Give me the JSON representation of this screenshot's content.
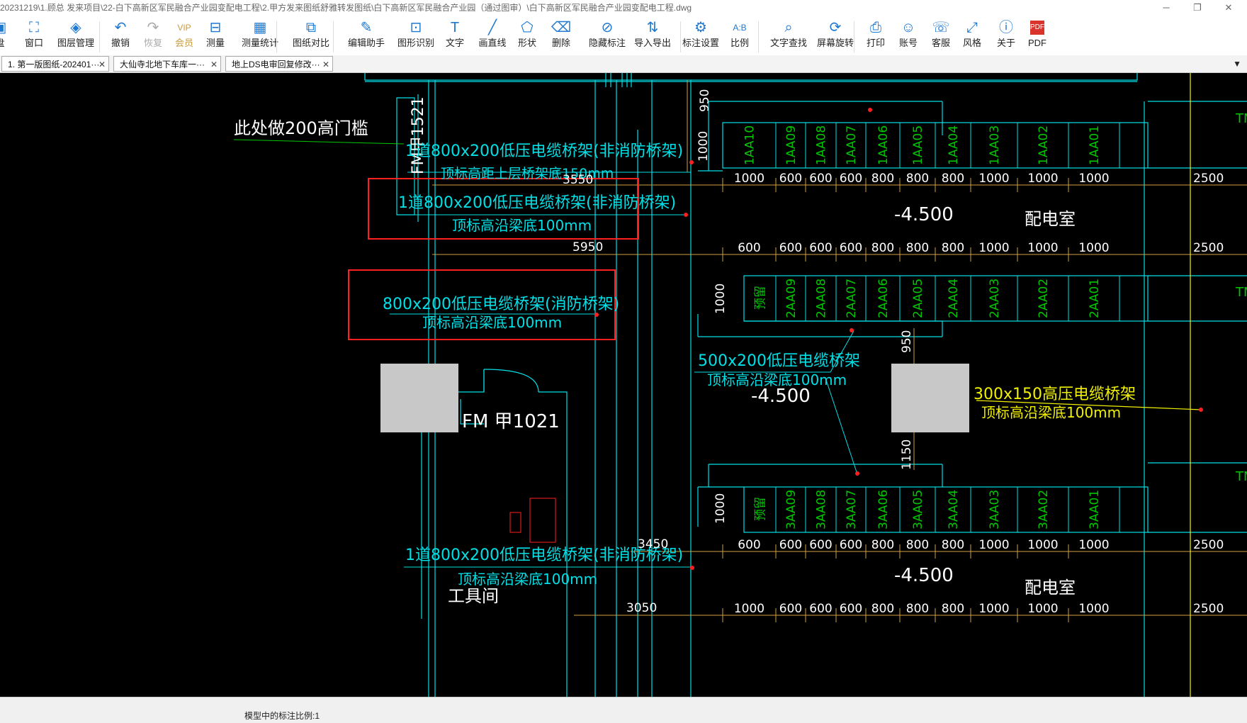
{
  "window": {
    "title": "20231219\\1.顾总 发来项目\\22-白下高新区军民融合产业园变配电工程\\2.甲方发来图纸舒雅转发图纸\\白下高新区军民融合产业园（通过图审）\\白下高新区军民融合产业园变配电工程.dwg",
    "minimize_glyph": "─",
    "maximize_glyph": "❐",
    "close_glyph": "✕"
  },
  "toolbar": [
    {
      "id": "disk",
      "label": "盘",
      "icon": "disk-icon",
      "glyph": "▣"
    },
    {
      "id": "window",
      "label": "窗口",
      "icon": "window-icon",
      "glyph": "⛶"
    },
    {
      "id": "layers",
      "label": "图层管理",
      "icon": "layers-icon",
      "glyph": "◈"
    },
    {
      "id": "undo",
      "label": "撤销",
      "icon": "undo-icon",
      "glyph": "↶"
    },
    {
      "id": "redo",
      "label": "恢复",
      "icon": "redo-icon",
      "glyph": "↷",
      "disabled": true
    },
    {
      "id": "vip",
      "label": "会员",
      "icon": "vip-icon",
      "glyph": "VIP",
      "vip": true
    },
    {
      "id": "measure",
      "label": "测量",
      "icon": "ruler-icon",
      "glyph": "⊟"
    },
    {
      "id": "measure_stats",
      "label": "测量统计",
      "icon": "measure-stats-icon",
      "glyph": "▦"
    },
    {
      "id": "compare",
      "label": "图纸对比",
      "icon": "compare-icon",
      "glyph": "⧉"
    },
    {
      "id": "edit_helper",
      "label": "编辑助手",
      "icon": "edit-helper-icon",
      "glyph": "✎"
    },
    {
      "id": "recognize",
      "label": "图形识别",
      "icon": "recognize-icon",
      "glyph": "⊡"
    },
    {
      "id": "text",
      "label": "文字",
      "icon": "text-icon",
      "glyph": "T"
    },
    {
      "id": "line",
      "label": "画直线",
      "icon": "line-icon",
      "glyph": "╱"
    },
    {
      "id": "shape",
      "label": "形状",
      "icon": "shape-icon",
      "glyph": "⬠"
    },
    {
      "id": "delete",
      "label": "删除",
      "icon": "eraser-icon",
      "glyph": "⌫"
    },
    {
      "id": "hide_annot",
      "label": "隐藏标注",
      "icon": "hide-icon",
      "glyph": "⊘"
    },
    {
      "id": "import_export",
      "label": "导入导出",
      "icon": "import-export-icon",
      "glyph": "⇅"
    },
    {
      "id": "annot_settings",
      "label": "标注设置",
      "icon": "annot-settings-icon",
      "glyph": "⚙"
    },
    {
      "id": "scale",
      "label": "比例",
      "icon": "scale-icon",
      "glyph": "A:B"
    },
    {
      "id": "find_text",
      "label": "文字查找",
      "icon": "find-text-icon",
      "glyph": "⌕"
    },
    {
      "id": "rotate_screen",
      "label": "屏幕旋转",
      "icon": "rotate-icon",
      "glyph": "⟳"
    },
    {
      "id": "print",
      "label": "打印",
      "icon": "printer-icon",
      "glyph": "⎙"
    },
    {
      "id": "account",
      "label": "账号",
      "icon": "account-icon",
      "glyph": "☺"
    },
    {
      "id": "service",
      "label": "客服",
      "icon": "headset-icon",
      "glyph": "☏"
    },
    {
      "id": "style",
      "label": "风格",
      "icon": "style-icon",
      "glyph": "⤢"
    },
    {
      "id": "about",
      "label": "关于",
      "icon": "info-icon",
      "glyph": "ⓘ"
    },
    {
      "id": "pdf",
      "label": "PDF",
      "icon": "pdf-icon",
      "glyph": "PDF"
    }
  ],
  "tabs": [
    {
      "label": "1. 第一版图纸-202401···",
      "close": "✕"
    },
    {
      "label": "大仙寺北地下车库一···",
      "close": "✕"
    },
    {
      "label": "地上DS电审回复修改···",
      "close": "✕"
    }
  ],
  "tab_menu": "▼",
  "status": {
    "text": "模型中的标注比例:1"
  },
  "colors": {
    "cyan": "#00e0e6",
    "green": "#00c800",
    "yellow": "#f0f000",
    "red": "#ff2020",
    "white": "#ffffff",
    "gray": "#c8c8c8",
    "orange": "#d0a040"
  },
  "drawing": {
    "notes": {
      "door_sill": "此处做200高门槛",
      "fm1521": "FM甲1521",
      "fm1021": "FM 甲1021",
      "tray1_a": "1道800x200低压电缆桥架(非消防桥架)",
      "tray1_b": "顶标高距上层桥架底150mm",
      "tray2_a": "1道800x200低压电缆桥架(非消防桥架)",
      "tray2_b": "顶标高沿梁底100mm",
      "tray3_a": "800x200低压电缆桥架(消防桥架)",
      "tray3_b": "顶标高沿梁底100mm",
      "tray4_a": "500x200低压电缆桥架",
      "tray4_b": "顶标高沿梁底100mm",
      "tray5_a": "300x150高压电缆桥架",
      "tray5_b": "顶标高沿梁底100mm",
      "tray6_a": "1道800x200低压电缆桥架(非消防桥架)",
      "tray6_b": "顶标高沿梁底100mm",
      "room_dist": "配电室",
      "room_tool": "工具间",
      "level": "-4.500"
    },
    "row1": [
      "1AA10",
      "1AA09",
      "1AA08",
      "1AA07",
      "1AA06",
      "1AA05",
      "1AA04",
      "1AA03",
      "1AA02",
      "1AA01"
    ],
    "row2": [
      "预留",
      "2AA09",
      "2AA08",
      "2AA07",
      "2AA06",
      "2AA05",
      "2AA04",
      "2AA03",
      "2AA02",
      "2AA01"
    ],
    "row3": [
      "预留",
      "3AA09",
      "3AA08",
      "3AA07",
      "3AA06",
      "3AA05",
      "3AA04",
      "3AA03",
      "3AA02",
      "3AA01"
    ],
    "dims_row_a": [
      "1000",
      "600",
      "600",
      "600",
      "800",
      "800",
      "800",
      "1000",
      "1000",
      "1000"
    ],
    "dims_row_b": [
      "600",
      "600",
      "600",
      "600",
      "800",
      "800",
      "800",
      "1000",
      "1000",
      "1000"
    ],
    "dims_row_c": [
      "600",
      "600",
      "600",
      "600",
      "800",
      "800",
      "800",
      "1000",
      "1000",
      "1000"
    ],
    "dims_row_d": [
      "1000",
      "600",
      "600",
      "600",
      "800",
      "800",
      "800",
      "1000",
      "1000",
      "1000"
    ],
    "dim_end": "2500",
    "dim_3550": "3550",
    "dim_5950": "5950",
    "dim_3450": "3450",
    "dim_3050": "3050",
    "dim_950": "950",
    "dim_1000": "1000",
    "dim_1150": "1150",
    "tm": "TM"
  }
}
